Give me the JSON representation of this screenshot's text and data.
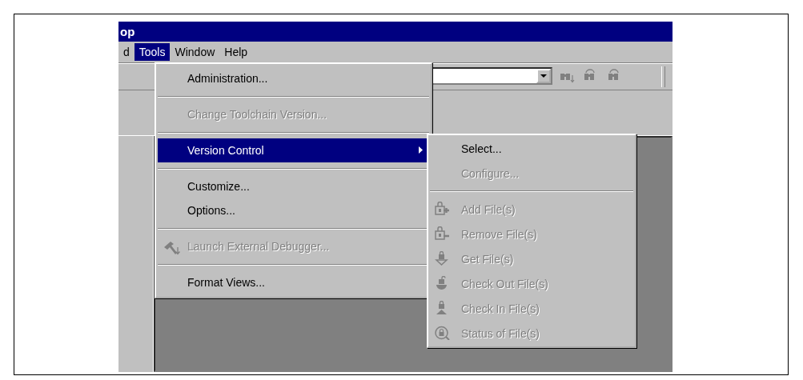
{
  "window": {
    "title": "op"
  },
  "menu_bar": [
    {
      "label": "d",
      "selected": false
    },
    {
      "label": "Tools",
      "selected": true
    },
    {
      "label": "Window",
      "selected": false
    },
    {
      "label": "Help",
      "selected": false
    }
  ],
  "tools_menu": {
    "items": [
      {
        "kind": "item",
        "label": "Administration...",
        "disabled": false,
        "selected": false
      },
      {
        "kind": "separator"
      },
      {
        "kind": "item",
        "label": "Change Toolchain Version...",
        "disabled": true,
        "selected": false
      },
      {
        "kind": "separator"
      },
      {
        "kind": "submenu",
        "label": "Version Control",
        "disabled": false,
        "selected": true
      },
      {
        "kind": "separator"
      },
      {
        "kind": "item",
        "label": "Customize...",
        "disabled": false,
        "selected": false
      },
      {
        "kind": "item",
        "label": "Options...",
        "disabled": false,
        "selected": false
      },
      {
        "kind": "separator"
      },
      {
        "kind": "icon_item",
        "label": "Launch External Debugger...",
        "disabled": true,
        "selected": false
      },
      {
        "kind": "separator"
      },
      {
        "kind": "item",
        "label": "Format Views...",
        "disabled": false,
        "selected": false
      }
    ]
  },
  "version_control_submenu": {
    "items": [
      {
        "kind": "item",
        "label": "Select...",
        "disabled": false
      },
      {
        "kind": "item",
        "label": "Configure...",
        "disabled": true
      },
      {
        "kind": "separator"
      },
      {
        "kind": "icon_item",
        "label": "Add File(s)",
        "disabled": true
      },
      {
        "kind": "icon_item",
        "label": "Remove File(s)",
        "disabled": true
      },
      {
        "kind": "icon_item",
        "label": "Get File(s)",
        "disabled": true
      },
      {
        "kind": "icon_item",
        "label": "Check Out File(s)",
        "disabled": true
      },
      {
        "kind": "icon_item",
        "label": "Check In File(s)",
        "disabled": true
      },
      {
        "kind": "icon_item",
        "label": "Status of File(s)",
        "disabled": true
      }
    ]
  }
}
